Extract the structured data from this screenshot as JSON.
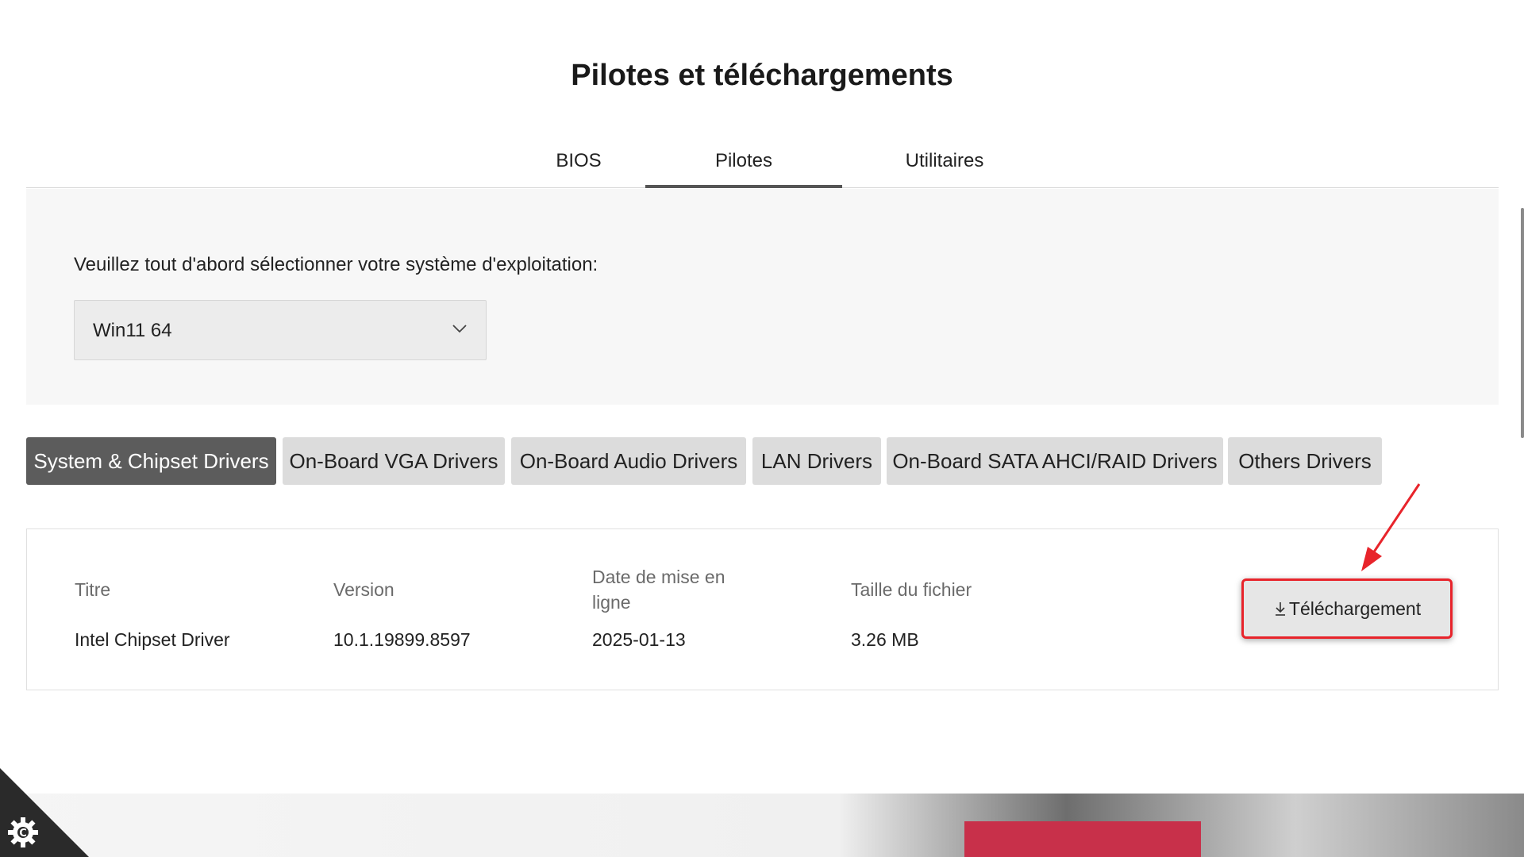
{
  "page": {
    "title": "Pilotes et téléchargements"
  },
  "tabs": [
    {
      "label": "BIOS",
      "active": false
    },
    {
      "label": "Pilotes",
      "active": true
    },
    {
      "label": "Utilitaires",
      "active": false
    }
  ],
  "os_selector": {
    "label": "Veuillez tout d'abord sélectionner votre système d'exploitation:",
    "selected": "Win11 64",
    "icon": "chevron-down-icon"
  },
  "categories": [
    {
      "label": "System & Chipset Drivers",
      "active": true
    },
    {
      "label": "On-Board VGA Drivers",
      "active": false
    },
    {
      "label": "On-Board Audio Drivers",
      "active": false
    },
    {
      "label": "LAN Drivers",
      "active": false
    },
    {
      "label": "On-Board SATA AHCI/RAID Drivers",
      "active": false
    },
    {
      "label": "Others Drivers",
      "active": false
    }
  ],
  "driver": {
    "headers": {
      "title": "Titre",
      "version": "Version",
      "date": "Date de mise en ligne",
      "size": "Taille du fichier"
    },
    "row": {
      "title": "Intel Chipset Driver",
      "version": "10.1.19899.8597",
      "date": "2025-01-13",
      "size": "3.26 MB"
    },
    "download_label": "Téléchargement",
    "download_icon": "download-icon"
  },
  "colors": {
    "active_category": "#5c5c5c",
    "inactive_category": "#dcdcdc",
    "annotation_red": "#e8242b"
  },
  "cookie_icon": "cookie-settings-icon"
}
